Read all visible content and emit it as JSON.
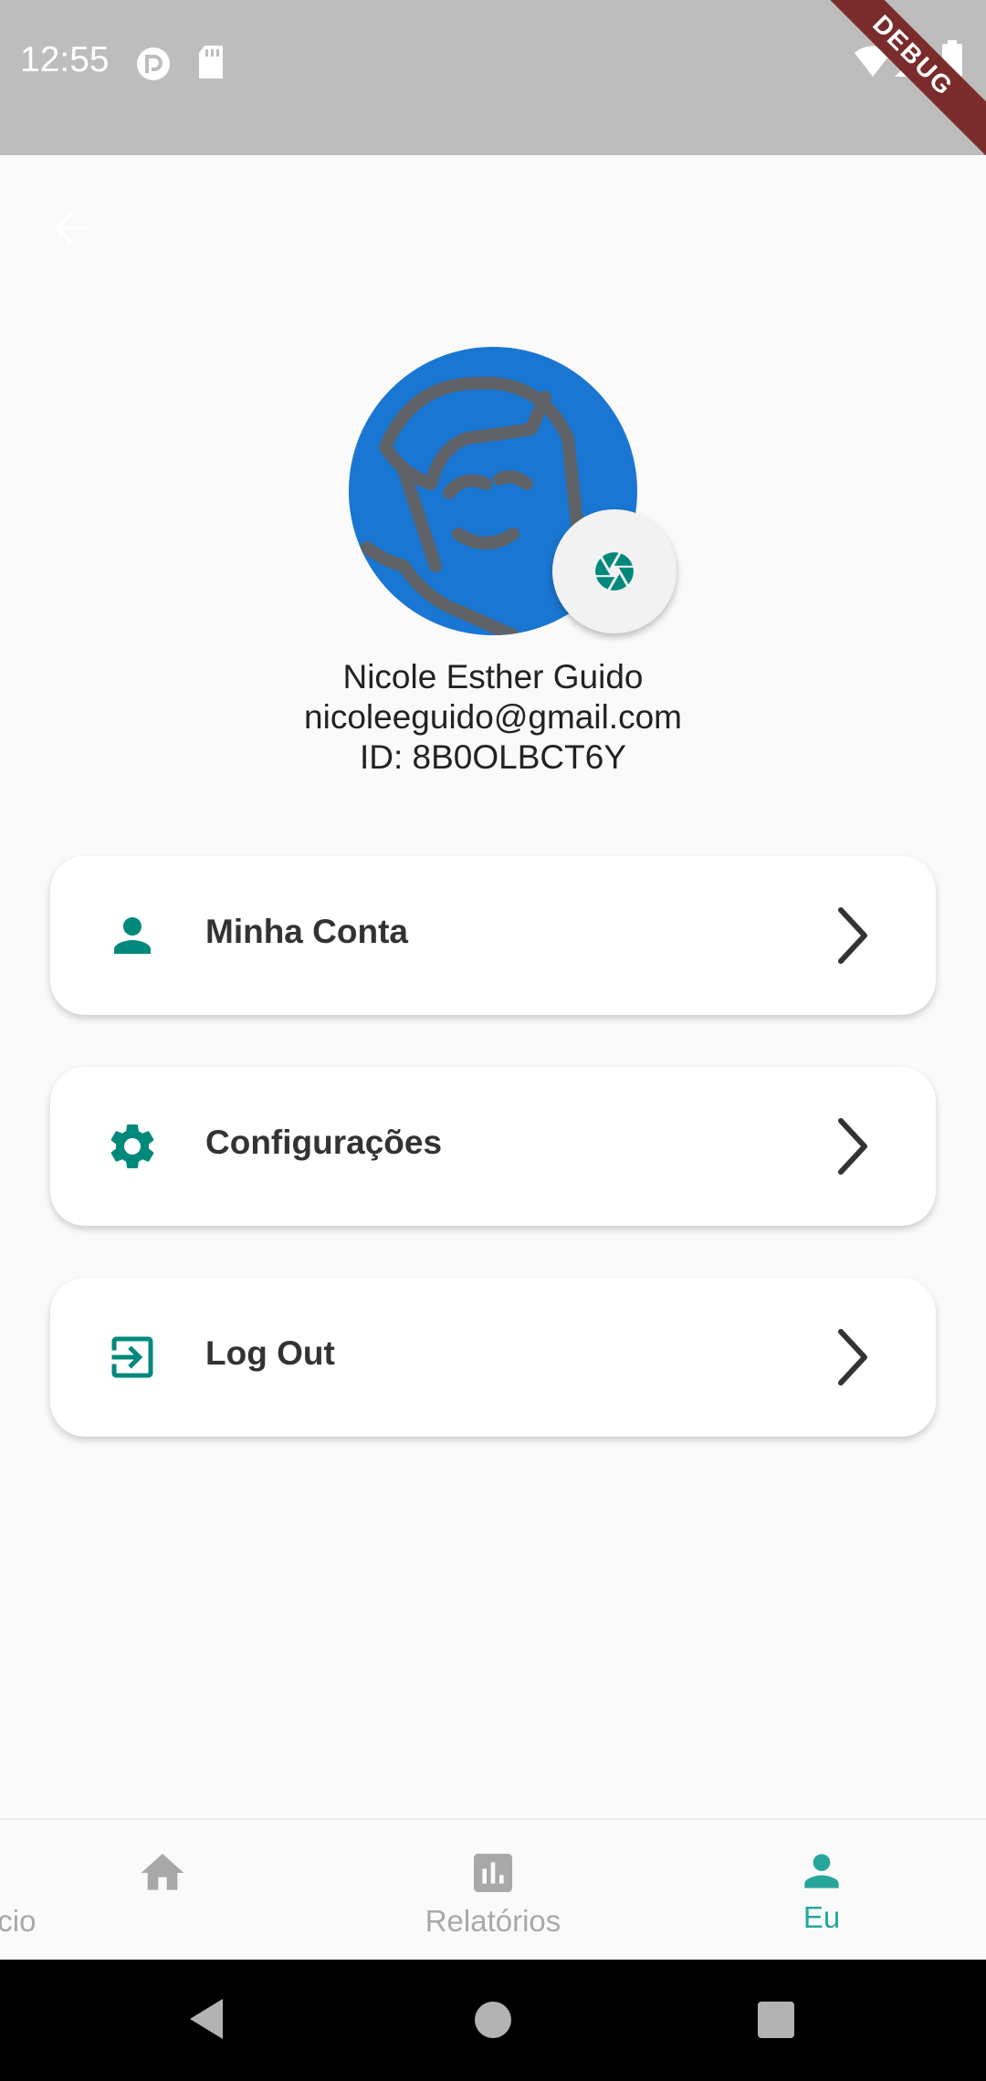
{
  "status_bar": {
    "time": "12:55",
    "icons": [
      "pocketcasts-icon",
      "sd-card-icon",
      "wifi-icon",
      "signal-icon",
      "battery-icon"
    ],
    "debug_banner": "DEBUG"
  },
  "profile": {
    "name": "Nicole Esther Guido",
    "email": "nicoleeguido@gmail.com",
    "id_text": "ID: 8B0OLBCT6Y"
  },
  "menu": {
    "items": [
      {
        "label": "Minha Conta",
        "icon": "person-icon"
      },
      {
        "label": "Configurações",
        "icon": "gear-icon"
      },
      {
        "label": "Log Out",
        "icon": "logout-icon"
      }
    ]
  },
  "bottom_nav": {
    "items": [
      {
        "label": "Início",
        "icon": "home-icon",
        "active": false
      },
      {
        "label": "Relatórios",
        "icon": "chart-icon",
        "active": false
      },
      {
        "label": "Eu",
        "icon": "person-icon",
        "active": true
      }
    ]
  },
  "colors": {
    "accent": "#26a69a",
    "teal_icon": "#00897b",
    "avatar_bg": "#1976d2",
    "status_bar": "#bdbdbd",
    "inactive_nav": "#a8a8a8"
  }
}
